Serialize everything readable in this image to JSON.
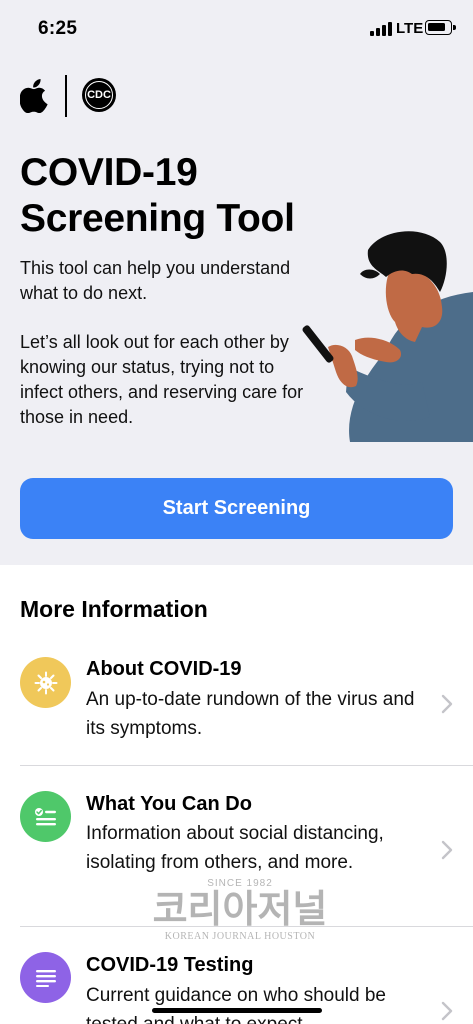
{
  "status_bar": {
    "time": "6:25",
    "network": "LTE"
  },
  "logos": {
    "cdc": "CDC"
  },
  "hero": {
    "title_line1": "COVID-19",
    "title_line2": "Screening Tool",
    "paragraph1": "This tool can help you understand what to do next.",
    "paragraph2": "Let’s all look out for each other by knowing our status, trying not to infect others, and reserving care for those in need.",
    "start_button": "Start Screening"
  },
  "more_info": {
    "heading": "More Information",
    "items": [
      {
        "title": "About COVID-19",
        "description": "An up-to-date rundown of the virus and its symptoms.",
        "icon": "virus-icon",
        "color": "#f0c85a"
      },
      {
        "title": "What You Can Do",
        "description": "Information about social distancing, isolating from others, and more.",
        "icon": "checklist-icon",
        "color": "#4fc86a"
      },
      {
        "title": "COVID-19 Testing",
        "description": "Current guidance on who should be tested and what to expect.",
        "icon": "list-icon",
        "color": "#8e63e6"
      }
    ]
  },
  "watermark": {
    "line1": "SINCE 1982",
    "line2": "코리아저널",
    "line3": "KOREAN JOURNAL HOUSTON"
  },
  "colors": {
    "accent": "#3b82f6",
    "top_background": "#efeff4"
  }
}
